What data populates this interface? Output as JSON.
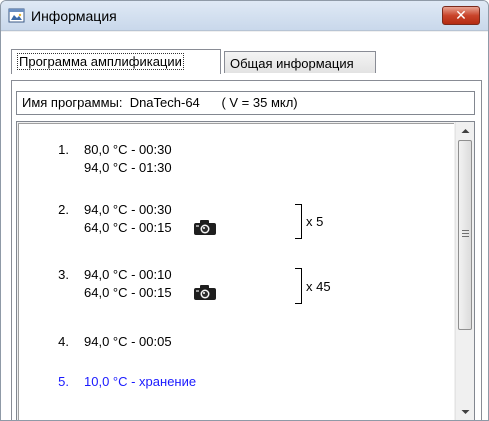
{
  "window": {
    "title": "Информация",
    "close_glyph": "✕"
  },
  "tabs": [
    {
      "label": "Программа амплификации",
      "active": true
    },
    {
      "label": "Общая информация",
      "active": false
    }
  ],
  "program_info": {
    "text": "Имя программы:  DnaTech-64      ( V = 35 мкл)"
  },
  "steps": [
    {
      "number": "1.",
      "lines": [
        "80,0 °C  -  00:30",
        "94,0 °C  -  01:30"
      ]
    },
    {
      "number": "2.",
      "lines": [
        "94,0 °C  -  00:30",
        "64,0 °C  -  00:15"
      ],
      "camera": true,
      "repeat": "x 5"
    },
    {
      "number": "3.",
      "lines": [
        "94,0 °C  -  00:10",
        "64,0 °C  -  00:15"
      ],
      "camera": true,
      "repeat": "x 45"
    },
    {
      "number": "4.",
      "lines": [
        "94,0 °C  -  00:05"
      ]
    },
    {
      "number": "5.",
      "lines": [
        "10,0 °C  -  хранение"
      ],
      "color": "#1a1aff"
    }
  ],
  "icons": {
    "title": "app-window-icon",
    "camera": "camera-icon",
    "scroll_up": "scroll-up-arrow-icon",
    "scroll_down": "scroll-down-arrow-icon",
    "grip": "scroll-grip-icon"
  },
  "colors": {
    "close_button": "#c9442b",
    "storage_step": "#1a1aff"
  }
}
